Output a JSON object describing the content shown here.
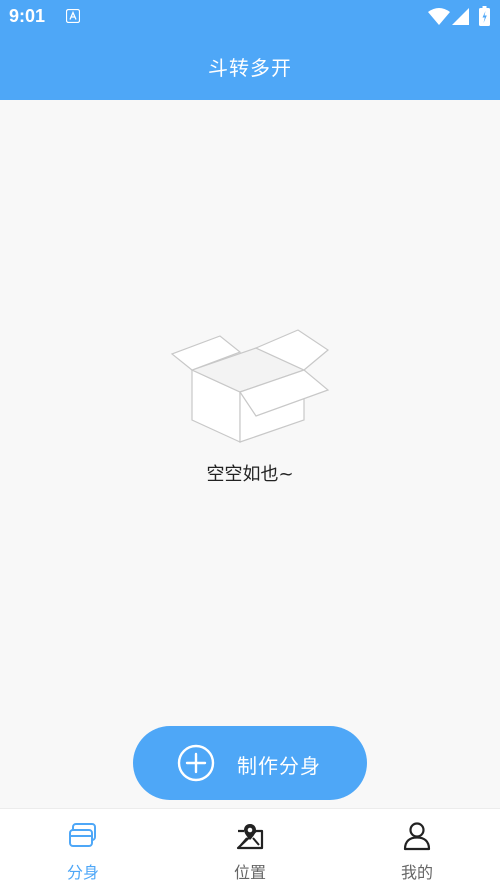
{
  "status_bar": {
    "time": "9:01",
    "notification_icon": "a-notification-icon",
    "wifi_icon": "wifi-icon",
    "signal_icon": "signal-icon",
    "battery_icon": "battery-charging-icon"
  },
  "header": {
    "title": "斗转多开"
  },
  "empty_state": {
    "icon": "empty-box-icon",
    "text": "空空如也~"
  },
  "fab": {
    "icon": "plus-circle-icon",
    "label": "制作分身"
  },
  "tabs": [
    {
      "label": "分身",
      "icon": "clone-cards-icon",
      "active": true
    },
    {
      "label": "位置",
      "icon": "location-map-icon",
      "active": false
    },
    {
      "label": "我的",
      "icon": "user-icon",
      "active": false
    }
  ],
  "colors": {
    "accent": "#4ea7f7",
    "background": "#f8f8f8",
    "tab_inactive": "#666666"
  }
}
